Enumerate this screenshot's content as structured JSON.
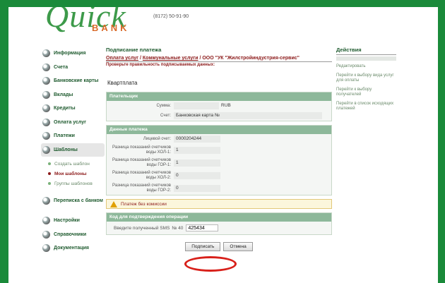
{
  "logo": {
    "word": "Quick",
    "bank": "BANK"
  },
  "header": {
    "phone": "(8172) 50-91-90"
  },
  "sidebar": {
    "items": [
      {
        "label": "Информация"
      },
      {
        "label": "Счета"
      },
      {
        "label": "Банковские карты"
      },
      {
        "label": "Вклады"
      },
      {
        "label": "Кредиты"
      },
      {
        "label": "Оплата услуг"
      },
      {
        "label": "Платежи"
      },
      {
        "label": "Шаблоны"
      },
      {
        "label": "Переписка с банком"
      },
      {
        "label": "Настройки"
      },
      {
        "label": "Справочники"
      },
      {
        "label": "Документация"
      }
    ],
    "subitems": [
      {
        "label": "Создать шаблон"
      },
      {
        "label": "Мои шаблоны"
      },
      {
        "label": "Группы шаблонов"
      }
    ]
  },
  "main": {
    "title": "Подписание платежа",
    "breadcrumb": {
      "part1": "Оплата услуг",
      "sep1": " / ",
      "part2": "Коммунальные услуги",
      "sep2": " / ",
      "part3": "ООО \"УК \"Жилстройиндустрия-сервис\""
    },
    "check_text": "Проверьте правильность подписываемых данных:",
    "payee": "Квартплата",
    "payer_section": {
      "header": "Плательщик",
      "sum_label": "Сумма:",
      "sum_value": "",
      "currency": "RUB",
      "account_label": "Счет:",
      "account_value": "Банковская карта №"
    },
    "payment_section": {
      "header": "Данные платежа",
      "rows": [
        {
          "label": "Лицевой счет:",
          "value": "0000204244"
        },
        {
          "label": "Разница показаний счетчиков воды ХОЛ-1:",
          "value": "1"
        },
        {
          "label": "Разница показаний счетчиков воды ГОР-1:",
          "value": "1"
        },
        {
          "label": "Разница показаний счетчиков воды ХОЛ-2:",
          "value": "0"
        },
        {
          "label": "Разница показаний счетчиков воды ГОР-2:",
          "value": "0"
        }
      ]
    },
    "warning": "Платеж без комиссии",
    "sms_section": {
      "header": "Код для подтверждения операции",
      "label": "Введите полученный SMS",
      "number": "№ 40",
      "code": "425434"
    },
    "buttons": {
      "sign": "Подписать",
      "cancel": "Отмена"
    }
  },
  "actions": {
    "title": "Действия",
    "links": [
      {
        "label": "Редактировать"
      },
      {
        "label": "Перейти к выбору вида услуг для оплаты"
      },
      {
        "label": "Перейти к выбору получателей"
      },
      {
        "label": "Перейти в список исходящих платежей"
      }
    ]
  }
}
